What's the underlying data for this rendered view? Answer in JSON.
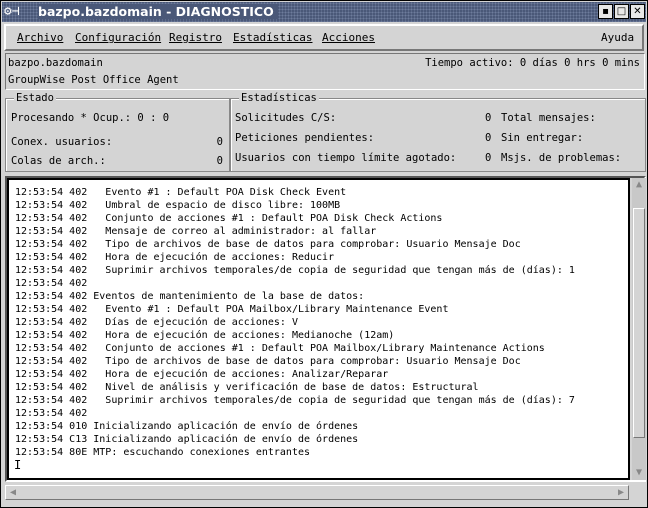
{
  "window": {
    "title": "bazpo.bazdomain - DIAGNOSTICO",
    "buttons": {
      "minimize": "▪",
      "maximize": "□",
      "close": "✕"
    }
  },
  "menu": [
    "Archivo",
    "Configuración",
    "Registro",
    "Estadísticas",
    "Acciones",
    "Ayuda"
  ],
  "info": {
    "server": "bazpo.bazdomain",
    "agent": "GroupWise Post Office Agent",
    "uptime": "Tiempo activo: 0 días 0 hrs 0 mins"
  },
  "estado": {
    "title": "Estado",
    "processing": "Procesando * Ocup.: 0 : 0",
    "user_conn_label": "Conex. usuarios:",
    "user_conn": "0",
    "file_queues_label": "Colas de arch.:",
    "file_queues": "0"
  },
  "stats": {
    "title": "Estadísticas",
    "rows": [
      {
        "label": "Solicitudes C/S:",
        "value": "0",
        "label2": "Total mensajes:"
      },
      {
        "label": "Peticiones pendientes:",
        "value": "0",
        "label2": "Sin entregar:"
      },
      {
        "label": "Usuarios con tiempo límite agotado:",
        "value": "0",
        "label2": "Msjs. de problemas:"
      }
    ]
  },
  "log": [
    "12:53:54 402   Evento #1 : Default POA Disk Check Event",
    "12:53:54 402   Umbral de espacio de disco libre: 100MB",
    "12:53:54 402   Conjunto de acciones #1 : Default POA Disk Check Actions",
    "12:53:54 402   Mensaje de correo al administrador: al fallar",
    "12:53:54 402   Tipo de archivos de base de datos para comprobar: Usuario Mensaje Doc",
    "12:53:54 402   Hora de ejecución de acciones: Reducir",
    "12:53:54 402   Suprimir archivos temporales/de copia de seguridad que tengan más de (días): 1",
    "12:53:54 402",
    "12:53:54 402 Eventos de mantenimiento de la base de datos:",
    "12:53:54 402   Evento #1 : Default POA Mailbox/Library Maintenance Event",
    "12:53:54 402   Días de ejecución de acciones: V",
    "12:53:54 402   Hora de ejecución de acciones: Medianoche (12am)",
    "12:53:54 402   Conjunto de acciones #1 : Default POA Mailbox/Library Maintenance Actions",
    "12:53:54 402   Tipo de archivos de base de datos para comprobar: Usuario Mensaje Doc",
    "12:53:54 402   Hora de ejecución de acciones: Analizar/Reparar",
    "12:53:54 402   Nivel de análisis y verificación de base de datos: Estructural",
    "12:53:54 402   Suprimir archivos temporales/de copia de seguridad que tengan más de (días): 7",
    "12:53:54 402",
    "12:53:54 010 Inicializando aplicación de envío de órdenes",
    "12:53:54 C13 Inicializando aplicación de envío de órdenes",
    "12:53:54 80E MTP: escuchando conexiones entrantes"
  ]
}
